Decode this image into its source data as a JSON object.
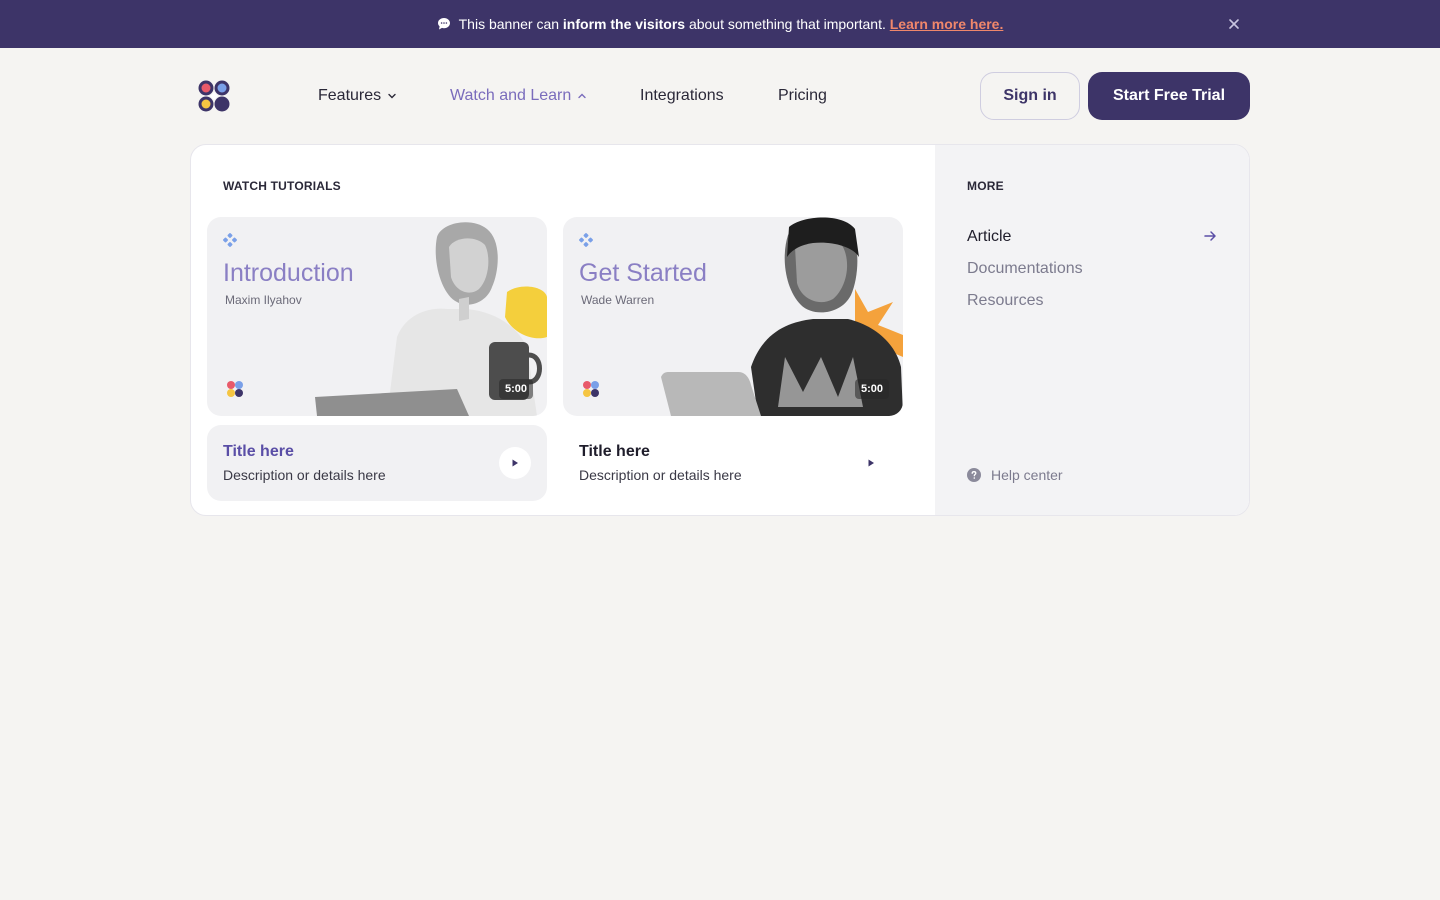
{
  "banner": {
    "text_before": "This banner can",
    "text_bold": "inform the visitors",
    "text_after": "about something that important.",
    "link": "Learn more here."
  },
  "nav": {
    "items": [
      {
        "label": "Features"
      },
      {
        "label": "Watch and Learn"
      },
      {
        "label": "Integrations"
      },
      {
        "label": "Pricing"
      }
    ],
    "sign_in": "Sign in",
    "trial": "Start Free Trial"
  },
  "dropdown": {
    "tutorials_label": "WATCH TUTORIALS",
    "videos": [
      {
        "title": "Introduction",
        "author": "Maxim Ilyahov",
        "duration": "5:00"
      },
      {
        "title": "Get Started",
        "author": "Wade Warren",
        "duration": "5:00"
      }
    ],
    "items": [
      {
        "title": "Title here",
        "description": "Description or details here"
      },
      {
        "title": "Title here",
        "description": "Description or details here"
      }
    ],
    "more_label": "MORE",
    "more_links": [
      {
        "label": "Article"
      },
      {
        "label": "Documentations"
      },
      {
        "label": "Resources"
      }
    ],
    "help": "Help center"
  },
  "colors": {
    "brand": "#3d3468",
    "accent": "#8a7fc4",
    "link": "#f0876b"
  }
}
